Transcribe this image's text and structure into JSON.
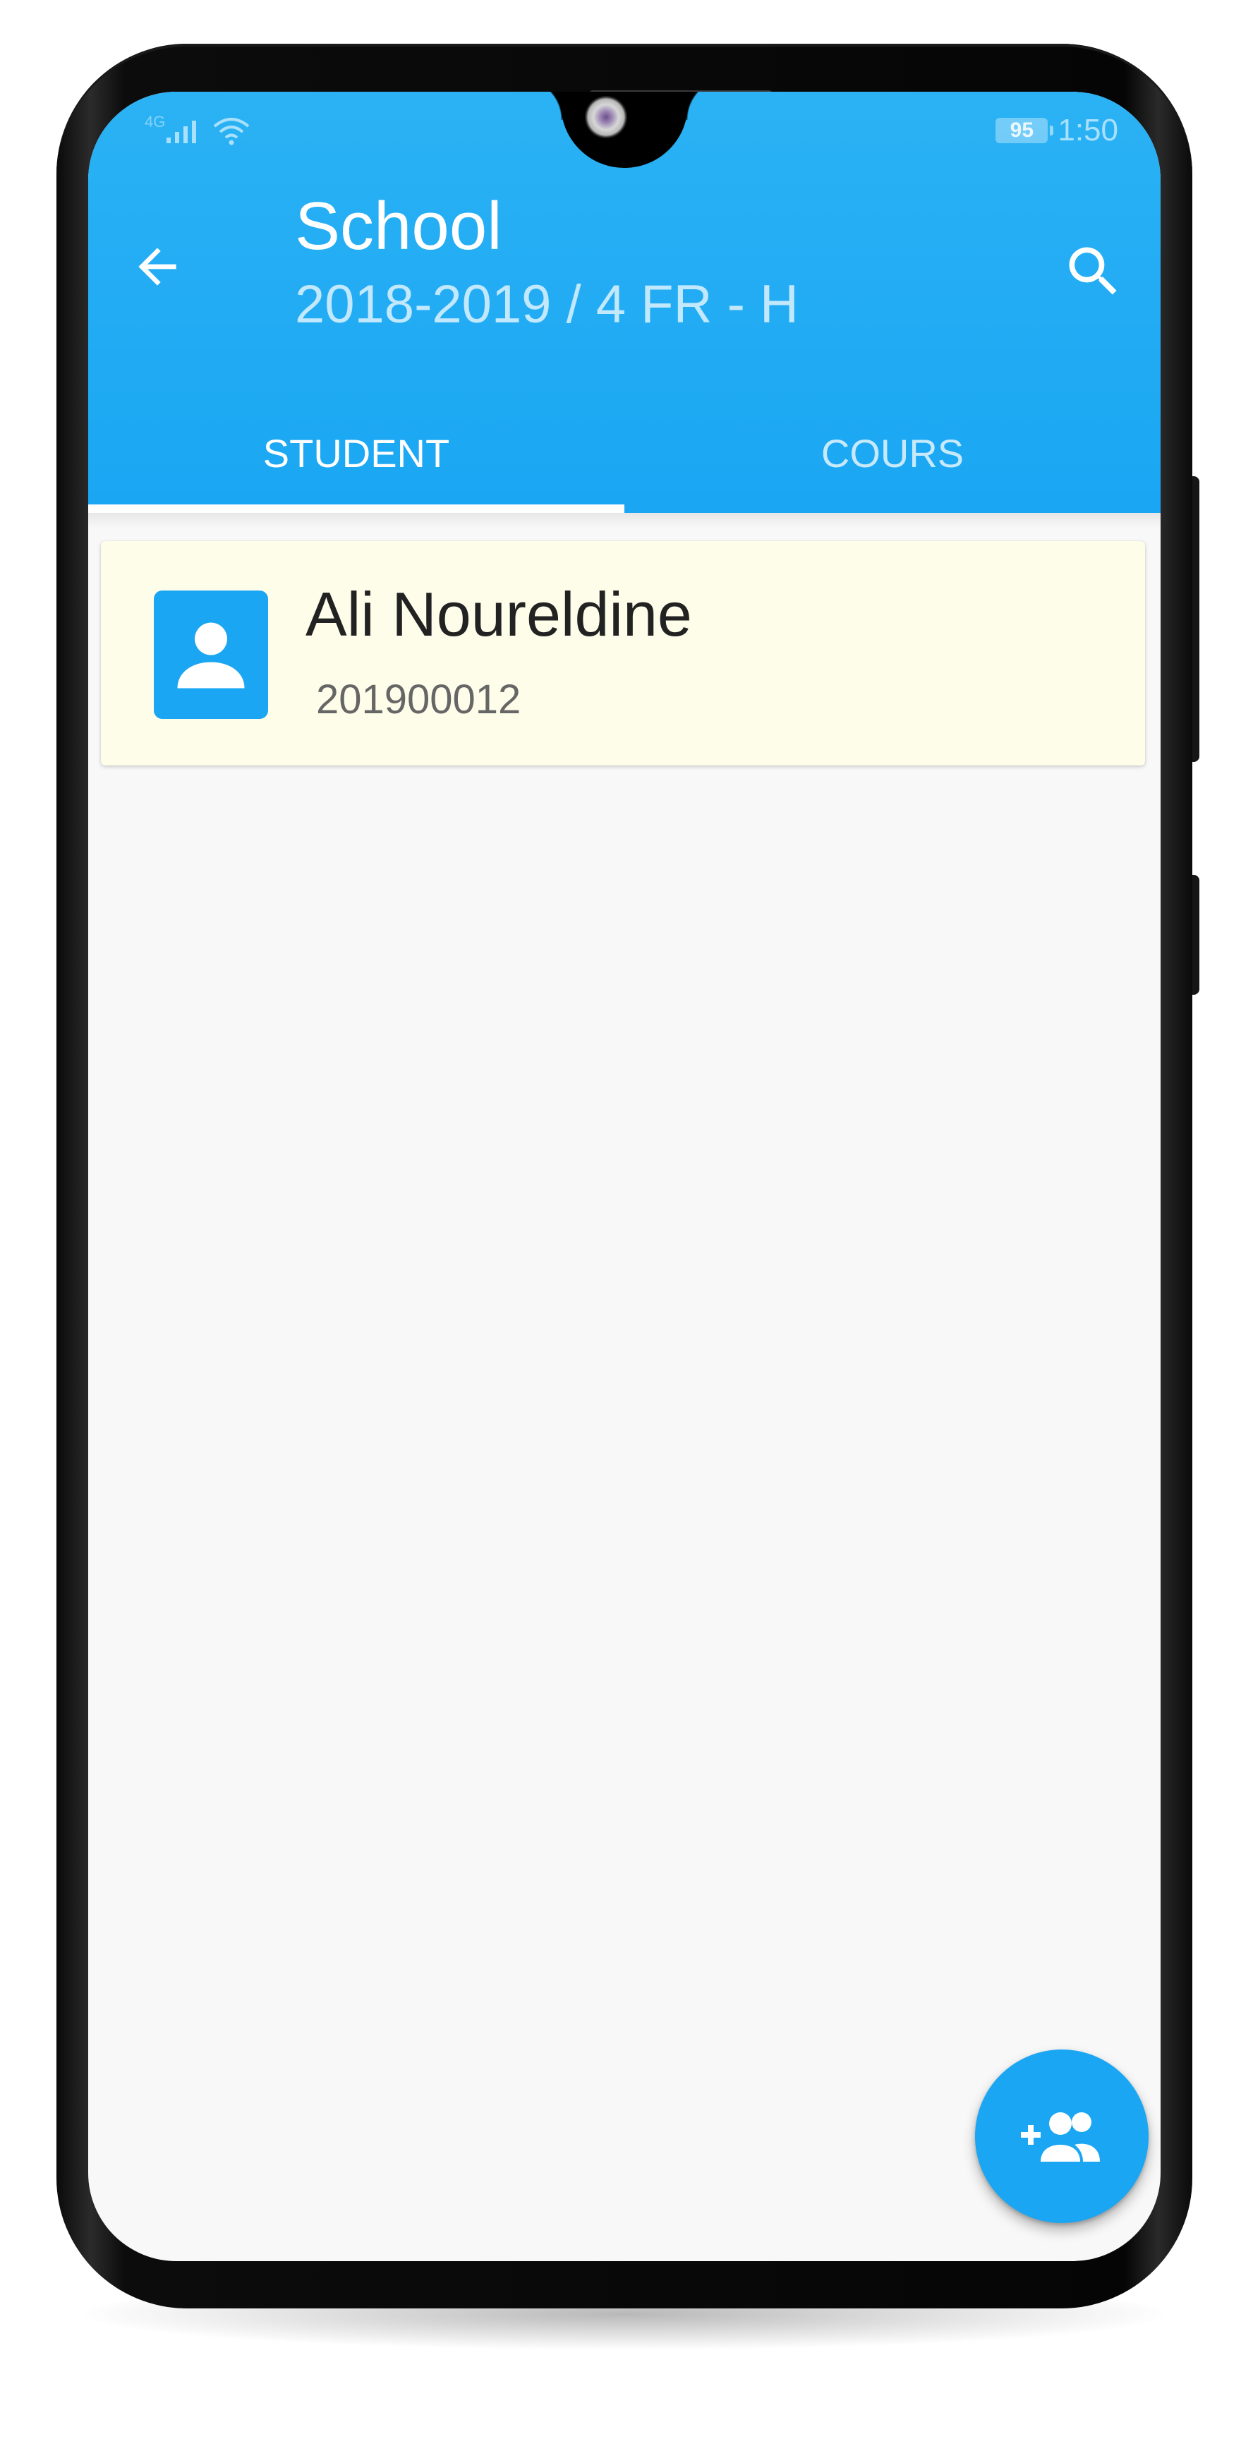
{
  "status_bar": {
    "network": "4G",
    "battery": "95",
    "time": "1:50"
  },
  "app_bar": {
    "title": "School",
    "subtitle": "2018-2019 / 4 FR - H",
    "back_icon": "arrow-back-icon",
    "search_icon": "search-icon"
  },
  "tabs": [
    {
      "label": "STUDENT",
      "active": true
    },
    {
      "label": "COURS",
      "active": false
    }
  ],
  "students": [
    {
      "name": "Ali Noureldine",
      "id": "201900012",
      "icon": "person-icon"
    }
  ],
  "fab": {
    "icon": "add-group-icon"
  },
  "colors": {
    "primary": "#1aa6f3",
    "card_background": "#fdfde9",
    "page_background": "#f8f8f8"
  }
}
